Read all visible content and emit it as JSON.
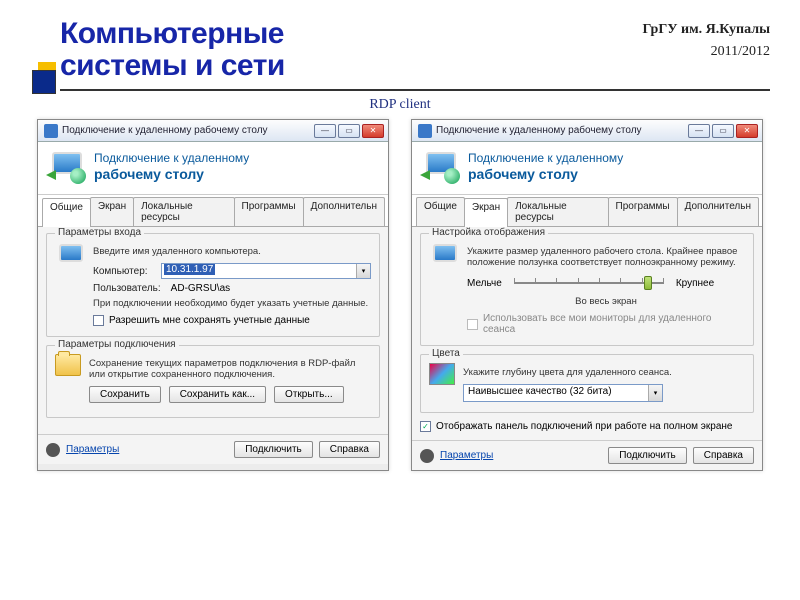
{
  "slide": {
    "title_l1": "Компьютерные",
    "title_l2": "системы и сети",
    "university": "ГрГУ им. Я.Купалы",
    "year": "2011/2012",
    "caption": "RDP client"
  },
  "common": {
    "window_title": "Подключение к удаленному рабочему столу",
    "banner_l1": "Подключение к удаленному",
    "banner_l2": "рабочему столу",
    "tabs": [
      "Общие",
      "Экран",
      "Локальные ресурсы",
      "Программы",
      "Дополнительн"
    ],
    "footer_params": "Параметры",
    "footer_connect": "Подключить",
    "footer_help": "Справка"
  },
  "left": {
    "active_tab": 0,
    "login_group": "Параметры входа",
    "login_hint": "Введите имя удаленного компьютера.",
    "computer_label": "Компьютер:",
    "computer_value": "10.31.1.97",
    "user_label": "Пользователь:",
    "user_value": "AD-GRSU\\as",
    "creds_note": "При подключении необходимо будет указать учетные данные.",
    "remember_label": "Разрешить мне сохранять учетные данные",
    "conn_group": "Параметры подключения",
    "conn_text": "Сохранение текущих параметров подключения в RDP-файл или открытие сохраненного подключения.",
    "btn_save": "Сохранить",
    "btn_save_as": "Сохранить как...",
    "btn_open": "Открыть..."
  },
  "right": {
    "active_tab": 1,
    "disp_group": "Настройка отображения",
    "disp_text": "Укажите размер удаленного рабочего стола. Крайнее правое положение ползунка соответствует полноэкранному режиму.",
    "smaller": "Мельче",
    "larger": "Крупнее",
    "fullscreen": "Во весь экран",
    "all_monitors": "Использовать все мои мониторы для удаленного сеанса",
    "colors_group": "Цвета",
    "colors_text": "Укажите глубину цвета для удаленного сеанса.",
    "colors_value": "Наивысшее качество (32 бита)",
    "show_bar": "Отображать панель подключений при работе на полном экране",
    "show_bar_checked": true
  }
}
